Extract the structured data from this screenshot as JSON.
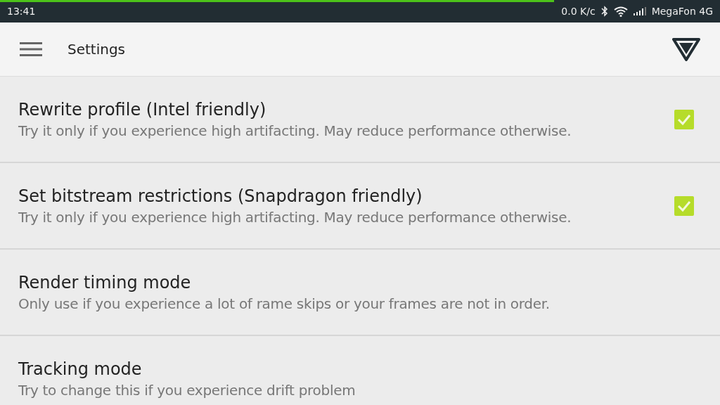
{
  "status_bar": {
    "time": "13:41",
    "speed": "0.0 K/c",
    "carrier": "MegaFon 4G"
  },
  "progress": {
    "level": 0.77
  },
  "toolbar": {
    "title": "Settings"
  },
  "settings": [
    {
      "kind": "checkbox",
      "title": "Rewrite profile (Intel friendly)",
      "summary": "Try it only if you experience high artifacting. May reduce performance otherwise.",
      "checked": true
    },
    {
      "kind": "checkbox",
      "title": "Set bitstream restrictions (Snapdragon friendly)",
      "summary": "Try it only if you experience high artifacting. May reduce performance otherwise.",
      "checked": true
    },
    {
      "kind": "plain",
      "title": "Render timing mode",
      "summary": "Only use if you experience a lot of rame skips or your frames are not in order."
    },
    {
      "kind": "plain",
      "title": "Tracking mode",
      "summary": "Try to change this if you experience drift problem"
    }
  ]
}
